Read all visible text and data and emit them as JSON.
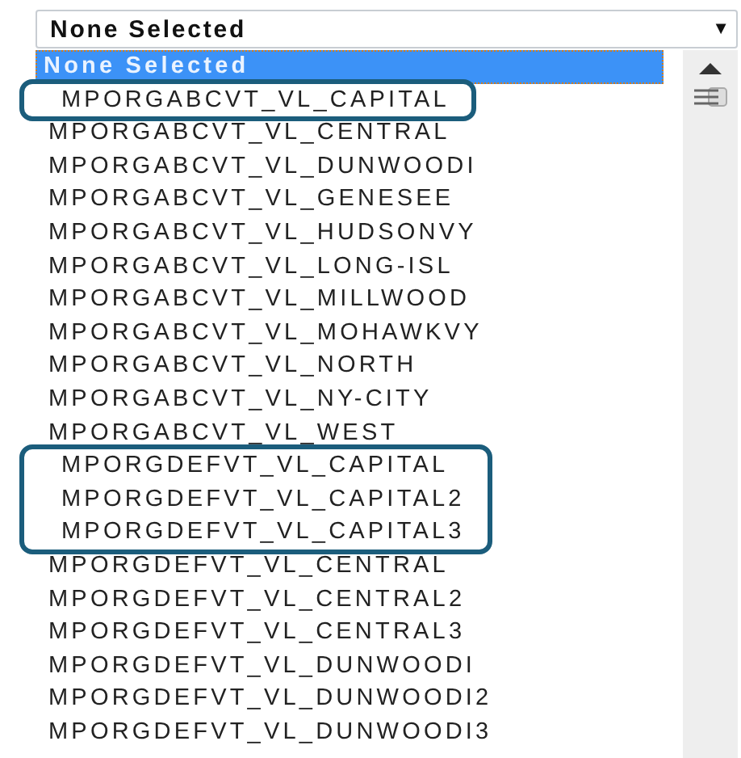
{
  "select": {
    "value": "None Selected",
    "arrow": "▼"
  },
  "options": [
    {
      "label": "None Selected",
      "selected": true,
      "outlined": false
    },
    {
      "label": "MPORGABCVT_VL_CAPITAL",
      "selected": false,
      "outlined": true
    },
    {
      "label": "MPORGABCVT_VL_CENTRAL",
      "selected": false,
      "outlined": false
    },
    {
      "label": "MPORGABCVT_VL_DUNWOODI",
      "selected": false,
      "outlined": false
    },
    {
      "label": "MPORGABCVT_VL_GENESEE",
      "selected": false,
      "outlined": false
    },
    {
      "label": "MPORGABCVT_VL_HUDSONVY",
      "selected": false,
      "outlined": false
    },
    {
      "label": "MPORGABCVT_VL_LONG-ISL",
      "selected": false,
      "outlined": false
    },
    {
      "label": "MPORGABCVT_VL_MILLWOOD",
      "selected": false,
      "outlined": false
    },
    {
      "label": "MPORGABCVT_VL_MOHAWKVY",
      "selected": false,
      "outlined": false
    },
    {
      "label": "MPORGABCVT_VL_NORTH",
      "selected": false,
      "outlined": false
    },
    {
      "label": "MPORGABCVT_VL_NY-CITY",
      "selected": false,
      "outlined": false
    },
    {
      "label": "MPORGABCVT_VL_WEST",
      "selected": false,
      "outlined": false
    },
    {
      "label": "MPORGDEFVT_VL_CAPITAL",
      "selected": false,
      "outlined": true
    },
    {
      "label": "MPORGDEFVT_VL_CAPITAL2",
      "selected": false,
      "outlined": true
    },
    {
      "label": "MPORGDEFVT_VL_CAPITAL3",
      "selected": false,
      "outlined": true
    },
    {
      "label": "MPORGDEFVT_VL_CENTRAL",
      "selected": false,
      "outlined": false
    },
    {
      "label": "MPORGDEFVT_VL_CENTRAL2",
      "selected": false,
      "outlined": false
    },
    {
      "label": "MPORGDEFVT_VL_CENTRAL3",
      "selected": false,
      "outlined": false
    },
    {
      "label": "MPORGDEFVT_VL_DUNWOODI",
      "selected": false,
      "outlined": false
    },
    {
      "label": "MPORGDEFVT_VL_DUNWOODI2",
      "selected": false,
      "outlined": false
    },
    {
      "label": "MPORGDEFVT_VL_DUNWOODI3",
      "selected": false,
      "outlined": false
    }
  ]
}
